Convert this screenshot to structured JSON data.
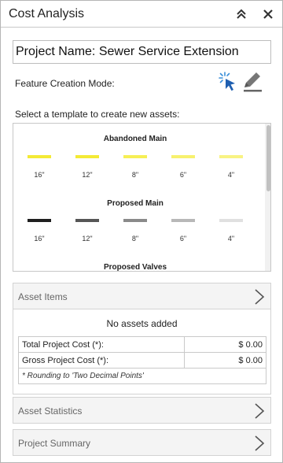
{
  "panel": {
    "title": "Cost Analysis",
    "collapse_icon": "double-chevron-up-icon",
    "close_icon": "close-icon"
  },
  "project": {
    "name": "Project Name: Sewer Service Extension"
  },
  "feature_mode": {
    "label": "Feature Creation Mode:",
    "select_icon": "select-cursor-icon",
    "edit_icon": "pencil-icon"
  },
  "templates": {
    "label": "Select a template to create new assets:",
    "groups": [
      {
        "title": "Abandoned Main",
        "items": [
          {
            "label": "16\"",
            "color": "#f4ea35"
          },
          {
            "label": "12\"",
            "color": "#f4ea35"
          },
          {
            "label": "8\"",
            "color": "#f6ef55"
          },
          {
            "label": "6\"",
            "color": "#f7f16e"
          },
          {
            "label": "4\"",
            "color": "#f8f383"
          }
        ]
      },
      {
        "title": "Proposed Main",
        "items": [
          {
            "label": "16\"",
            "color": "#1f1f1f"
          },
          {
            "label": "12\"",
            "color": "#565656"
          },
          {
            "label": "8\"",
            "color": "#8a8a8a"
          },
          {
            "label": "6\"",
            "color": "#b8b8b8"
          },
          {
            "label": "4\"",
            "color": "#e0e0e0"
          }
        ]
      },
      {
        "title": "Proposed Valves",
        "items": []
      }
    ]
  },
  "sections": {
    "asset_items": "Asset Items",
    "asset_statistics": "Asset Statistics",
    "project_summary": "Project Summary"
  },
  "assets": {
    "empty_message": "No assets added",
    "total_label": "Total Project Cost (*):",
    "total_value": "$ 0.00",
    "gross_label": "Gross Project Cost (*):",
    "gross_value": "$ 0.00",
    "rounding_note": "* Rounding to 'Two Decimal Points'"
  }
}
